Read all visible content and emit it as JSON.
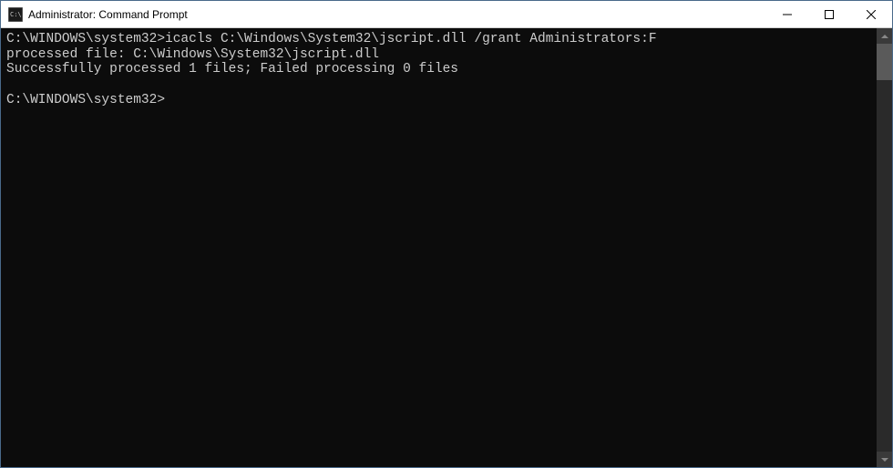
{
  "window": {
    "title": "Administrator: Command Prompt"
  },
  "console": {
    "lines": [
      "C:\\WINDOWS\\system32>icacls C:\\Windows\\System32\\jscript.dll /grant Administrators:F",
      "processed file: C:\\Windows\\System32\\jscript.dll",
      "Successfully processed 1 files; Failed processing 0 files",
      "",
      "C:\\WINDOWS\\system32>"
    ]
  }
}
